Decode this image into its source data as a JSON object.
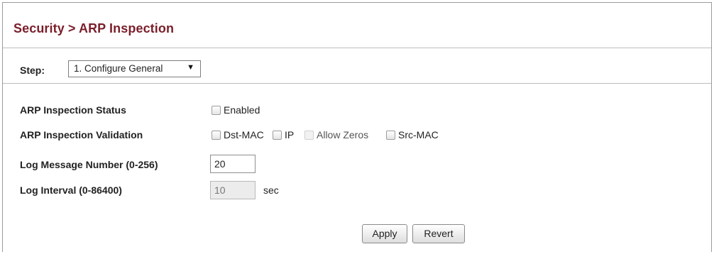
{
  "breadcrumb": "Security > ARP Inspection",
  "step": {
    "label": "Step:",
    "selected": "1. Configure General",
    "arrow": "▼"
  },
  "rows": {
    "status": {
      "label": "ARP Inspection Status",
      "checkbox_label": "Enabled",
      "checked": false
    },
    "validation": {
      "label": "ARP Inspection Validation",
      "options": [
        {
          "label": "Dst-MAC",
          "checked": false,
          "disabled": false
        },
        {
          "label": "IP",
          "checked": false,
          "disabled": false
        },
        {
          "label": "Allow Zeros",
          "checked": false,
          "disabled": true
        },
        {
          "label": "Src-MAC",
          "checked": false,
          "disabled": false
        }
      ]
    },
    "log_message": {
      "label": "Log Message Number (0-256)",
      "value": "20"
    },
    "log_interval": {
      "label": "Log Interval (0-86400)",
      "value": "10",
      "unit": "sec",
      "disabled": true
    }
  },
  "buttons": {
    "apply": "Apply",
    "revert": "Revert"
  },
  "colors": {
    "title": "#7a1f2b",
    "border": "#9a9a9a"
  }
}
